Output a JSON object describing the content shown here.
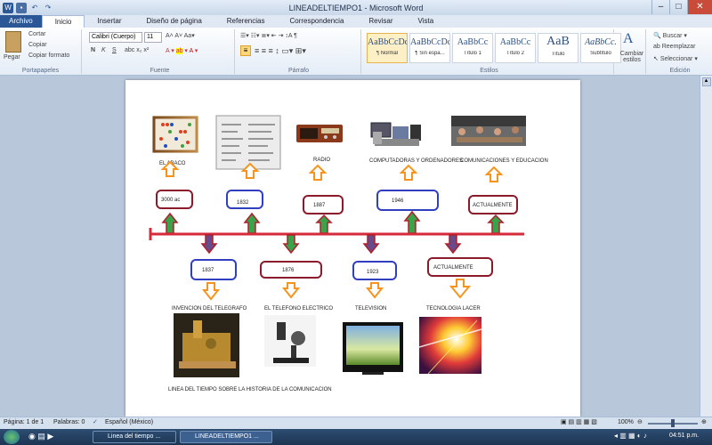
{
  "window": {
    "title": "LINEADELTIEMPO1 - Microsoft Word",
    "minimize": "–",
    "maximize": "□",
    "close": "✕"
  },
  "tabs": [
    "Archivo",
    "Inicio",
    "Insertar",
    "Diseño de página",
    "Referencias",
    "Correspondencia",
    "Revisar",
    "Vista"
  ],
  "ribbon": {
    "clipboard": {
      "paste": "Pegar",
      "cut": "Cortar",
      "copy": "Copiar",
      "format_painter": "Copiar formato",
      "label": "Portapapeles"
    },
    "font": {
      "family": "Calibri (Cuerpo)",
      "size": "11",
      "label": "Fuente"
    },
    "paragraph": {
      "label": "Párrafo"
    },
    "styles": {
      "label": "Estilos",
      "items": [
        {
          "sample": "AaBbCcDc",
          "name": "¶ Normal"
        },
        {
          "sample": "AaBbCcDc",
          "name": "¶ Sin espa..."
        },
        {
          "sample": "AaBbCc",
          "name": "Título 1"
        },
        {
          "sample": "AaBbCc",
          "name": "Título 2"
        },
        {
          "sample": "AaB",
          "name": "Título"
        },
        {
          "sample": "AaBbCc.",
          "name": "Subtítulo"
        }
      ],
      "change": "Cambiar estilos"
    },
    "editing": {
      "find": "Buscar",
      "replace": "Reemplazar",
      "select": "Seleccionar",
      "label": "Edición"
    }
  },
  "document": {
    "top": [
      {
        "caption": "EL    ABACO",
        "year": "3000 ac"
      },
      {
        "caption": "",
        "year": "1832"
      },
      {
        "caption": "RADIO",
        "year": "1887"
      },
      {
        "caption": "COMPUTADORAS  Y ORDENADORES",
        "year": "1946"
      },
      {
        "caption": "COMUNICACIONES Y EDUCACION",
        "year": "ACTUALMENTE"
      }
    ],
    "bottom": [
      {
        "caption": "INVENCION DEL TELEGRAFO",
        "year": "1837"
      },
      {
        "caption": "EL TELEFONO ELECTRICO",
        "year": "1876"
      },
      {
        "caption": "TELEVISION",
        "year": "1923"
      },
      {
        "caption": "TECNOLOGIA LACER",
        "year": "ACTUALMENTE"
      }
    ],
    "footer": "LINEA DEL TIEMPO SOBRE LA HISTORIA DE LA COMUNICACION"
  },
  "status": {
    "page": "Página: 1 de 1",
    "words": "Palabras: 0",
    "language": "Español (México)",
    "zoom": "100%"
  },
  "taskbar": {
    "item1": "Linea del tiempo ...",
    "item2": "LINEADELTIEMPO1 ...",
    "time": "04:51 p.m."
  },
  "colors": {
    "timeline_red": "#d42a3a",
    "arrow_orange": "#f7941d",
    "arrow_green": "#3aa24a",
    "box_red": "#8b1a2b",
    "box_blue": "#2f3fc0"
  }
}
